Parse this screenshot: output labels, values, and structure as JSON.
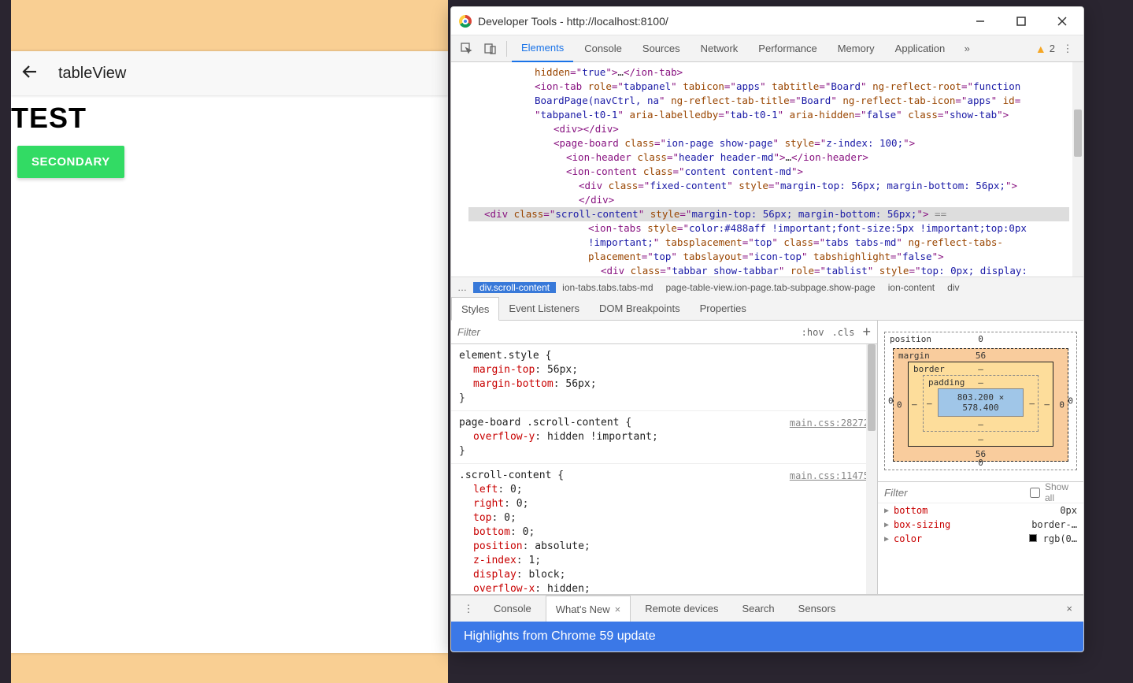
{
  "mobile": {
    "title": "tableView",
    "heading": "TEST",
    "secondary_btn": "SECONDARY"
  },
  "devtools": {
    "window_title": "Developer Tools - http://localhost:8100/",
    "tabs": [
      "Elements",
      "Console",
      "Sources",
      "Network",
      "Performance",
      "Memory",
      "Application"
    ],
    "warnings": "2",
    "breadcrumbs": [
      "…",
      "div.scroll-content",
      "ion-tabs.tabs.tabs-md",
      "page-table-view.ion-page.tab-subpage.show-page",
      "ion-content",
      "div"
    ],
    "subtabs": [
      "Styles",
      "Event Listeners",
      "DOM Breakpoints",
      "Properties"
    ],
    "filter_placeholder": "Filter",
    "hov": ":hov",
    "cls": ".cls",
    "rules": {
      "r1_sel": "element.style {",
      "r1_p1": "margin-top",
      "r1_v1": "56px",
      "r1_p2": "margin-bottom",
      "r1_v2": "56px",
      "r2_sel": "page-board .scroll-content {",
      "r2_src": "main.css:28272",
      "r2_p1": "overflow-y",
      "r2_v1": "hidden !important",
      "r3_sel": ".scroll-content {",
      "r3_src": "main.css:11475",
      "r3_p1": "left",
      "r3_v1": "0",
      "r3_p2": "right",
      "r3_v2": "0",
      "r3_p3": "top",
      "r3_v3": "0",
      "r3_p4": "bottom",
      "r3_v4": "0",
      "r3_p5": "position",
      "r3_v5": "absolute",
      "r3_p6": "z-index",
      "r3_v6": "1",
      "r3_p7": "display",
      "r3_v7": "block",
      "r3_p8": "overflow-x",
      "r3_v8": "hidden"
    },
    "boxmodel": {
      "position": "position",
      "pos_t": "0",
      "margin": "margin",
      "m_t": "56",
      "m_b": "56",
      "m_l": "0",
      "m_r": "0",
      "border": "border",
      "b": "–",
      "padding": "padding",
      "p": "–",
      "content": "803.200 × 578.400"
    },
    "computed_filter": "Filter",
    "show_all": "Show all",
    "computed": [
      {
        "prop": "bottom",
        "val": "0px"
      },
      {
        "prop": "box-sizing",
        "val": "border-…"
      },
      {
        "prop": "color",
        "val": "rgb(0…"
      }
    ],
    "drawer_tabs": [
      "Console",
      "What's New",
      "Remote devices",
      "Search",
      "Sensors"
    ],
    "banner": "Highlights from Chrome 59 update"
  },
  "tree": {
    "l0a": "hidden",
    "l0b": "true",
    "l0c": "ion-tab",
    "l1_tag": "ion-tab",
    "l1_a1": "role",
    "l1_v1": "tabpanel",
    "l1_a2": "tabicon",
    "l1_v2": "apps",
    "l1_a3": "tabtitle",
    "l1_v3": "Board",
    "l1_a4": "ng-reflect-root",
    "l1_v4": "function",
    "l2": "BoardPage(navCtrl, na",
    "l2_a1": "ng-reflect-tab-title",
    "l2_v1": "Board",
    "l2_a2": "ng-reflect-tab-icon",
    "l2_v2": "apps",
    "l2_a3": "id",
    "l3_v1": "tabpanel-t0-1",
    "l3_a1": "aria-labelledby",
    "l3_v2": "tab-t0-1",
    "l3_a2": "aria-hidden",
    "l3_v3": "false",
    "l3_a3": "class",
    "l3_v4": "show-tab",
    "l4": "div",
    "l5_tag": "page-board",
    "l5_a1": "class",
    "l5_v1": "ion-page show-page",
    "l5_a2": "style",
    "l5_v2": "z-index: 100;",
    "l6_tag": "ion-header",
    "l6_a1": "class",
    "l6_v1": "header header-md",
    "l6_end": "ion-header",
    "l7_tag": "ion-content",
    "l7_a1": "class",
    "l7_v1": "content content-md",
    "l8_tag": "div",
    "l8_a1": "class",
    "l8_v1": "fixed-content",
    "l8_a2": "style",
    "l8_v2": "margin-top: 56px; margin-bottom: 56px;",
    "l9": "div",
    "sel_tag": "div",
    "sel_a1": "class",
    "sel_v1": "scroll-content",
    "sel_a2": "style",
    "sel_v2": "margin-top: 56px; margin-bottom: 56px;",
    "sel_eq": " == ",
    "l10_tag": "ion-tabs",
    "l10_a1": "style",
    "l10_v1": "color:#488aff !important;font-size:5px !important;top:0px",
    "l11": "!important;",
    "l11_a1": "tabsplacement",
    "l11_v1": "top",
    "l11_a2": "class",
    "l11_v2": "tabs tabs-md",
    "l11_a3": "ng-reflect-tabs-",
    "l12": "placement",
    "l12_v1": "top",
    "l12_a1": "tabslayout",
    "l12_v2": "icon-top",
    "l12_a2": "tabshighlight",
    "l12_v3": "false",
    "l13_tag": "div",
    "l13_a1": "class",
    "l13_v1": "tabbar show-tabbar",
    "l13_a2": "role",
    "l13_v2": "tablist",
    "l13_a3": "style",
    "l13_v3": "top: 0px; display:"
  }
}
